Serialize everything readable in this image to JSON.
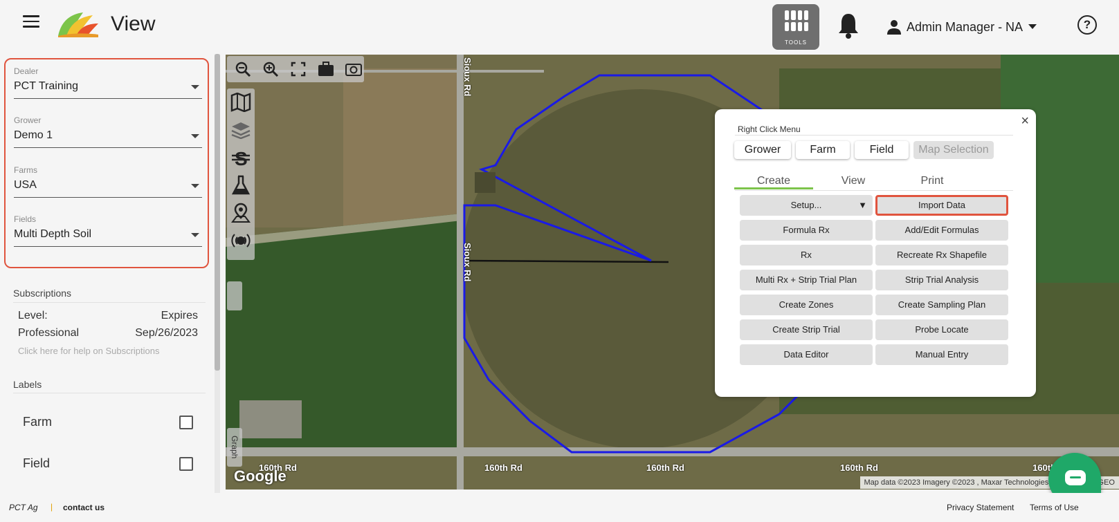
{
  "header": {
    "title": "View",
    "tools_label": "TOOLS",
    "user_name": "Admin Manager - NA"
  },
  "sidebar": {
    "dealer": {
      "label": "Dealer",
      "value": "PCT Training"
    },
    "grower": {
      "label": "Grower",
      "value": "Demo 1"
    },
    "farms": {
      "label": "Farms",
      "value": "USA"
    },
    "fields": {
      "label": "Fields",
      "value": "Multi Depth Soil"
    },
    "subscriptions": {
      "title": "Subscriptions",
      "level_label": "Level:",
      "expires_label": "Expires",
      "level_value": "Professional",
      "expires_value": "Sep/26/2023",
      "help_text": "Click here for help on Subscriptions"
    },
    "labels": {
      "title": "Labels",
      "items": [
        "Farm",
        "Field"
      ]
    }
  },
  "map": {
    "google_logo": "Google",
    "road_labels": [
      "Sioux Rd",
      "Sioux Rd",
      "160th Rd",
      "160th Rd",
      "160th Rd",
      "160th Rd",
      "160th Rd"
    ],
    "attribution": "Map data ©2023 Imagery ©2023 , Maxar Technologies, USDA/FPAC/GEO",
    "graph_label": "Graph"
  },
  "right_click_menu": {
    "title": "Right Click Menu",
    "close": "×",
    "context_tabs": [
      "Grower",
      "Farm",
      "Field",
      "Map Selection"
    ],
    "mode_tabs": [
      "Create",
      "View",
      "Print"
    ],
    "active_mode": "Create",
    "setup_label": "Setup...",
    "setup_arrow": "▼",
    "buttons_left": [
      "Formula Rx",
      "Rx",
      "Multi Rx + Strip Trial Plan",
      "Create Zones",
      "Create Strip Trial",
      "Data Editor"
    ],
    "buttons_right": [
      "Import Data",
      "Add/Edit Formulas",
      "Recreate Rx Shapefile",
      "Strip Trial Analysis",
      "Create Sampling Plan",
      "Probe Locate",
      "Manual Entry"
    ]
  },
  "footer": {
    "brand": "PCT Ag",
    "separator": "|",
    "contact": "contact us",
    "privacy": "Privacy Statement",
    "terms": "Terms of Use"
  },
  "colors": {
    "highlight": "#e0543e",
    "active_tab": "#7cc44a",
    "field_boundary": "#1a1ae6",
    "chat": "#1fa868"
  },
  "icons": [
    "menu-icon",
    "logo-icon",
    "grid-icon",
    "bell-icon",
    "person-icon",
    "chevron-down-icon",
    "help-icon",
    "zoom-out-icon",
    "zoom-in-icon",
    "fullscreen-icon",
    "briefcase-icon",
    "camera-icon",
    "map-icon",
    "layers-icon",
    "s-icon",
    "flask-icon",
    "location-icon",
    "sensor-icon",
    "chat-icon"
  ]
}
